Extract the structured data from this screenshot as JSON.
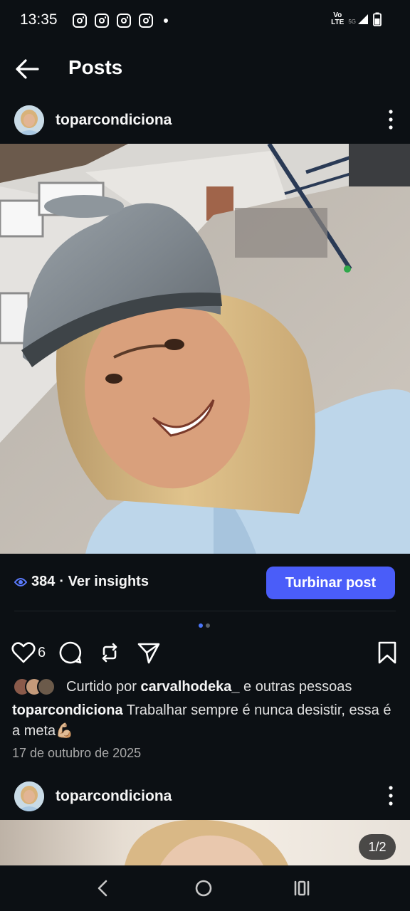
{
  "status_bar": {
    "time": "13:35",
    "notification_icons": [
      "instagram-icon",
      "instagram-icon",
      "instagram-icon",
      "instagram-icon"
    ],
    "network_label_top": "Vo",
    "network_label_bottom": "LTE",
    "network_5g": "5G"
  },
  "header": {
    "title": "Posts"
  },
  "post": {
    "username": "toparcondiciona",
    "views": "384",
    "insights_label": "· Ver insights",
    "boost_label": "Turbinar post",
    "like_count": "6",
    "liked_by_prefix": "Curtido por",
    "liked_by_user": "carvalhodeka_",
    "liked_by_suffix": "e outras pessoas",
    "caption_user": "toparcondiciona",
    "caption_text": "Trabalhar sempre é nunca desistir, essa é a meta💪🏼",
    "date": "17 de outubro de 2025",
    "carousel_pages": 2,
    "carousel_active": 1
  },
  "next_post": {
    "username": "toparcondiciona",
    "page_counter": "1/2"
  },
  "colors": {
    "background": "#0c1014",
    "accent": "#4a5df9",
    "text": "#f5f5f5",
    "muted": "#a8a8a8"
  }
}
